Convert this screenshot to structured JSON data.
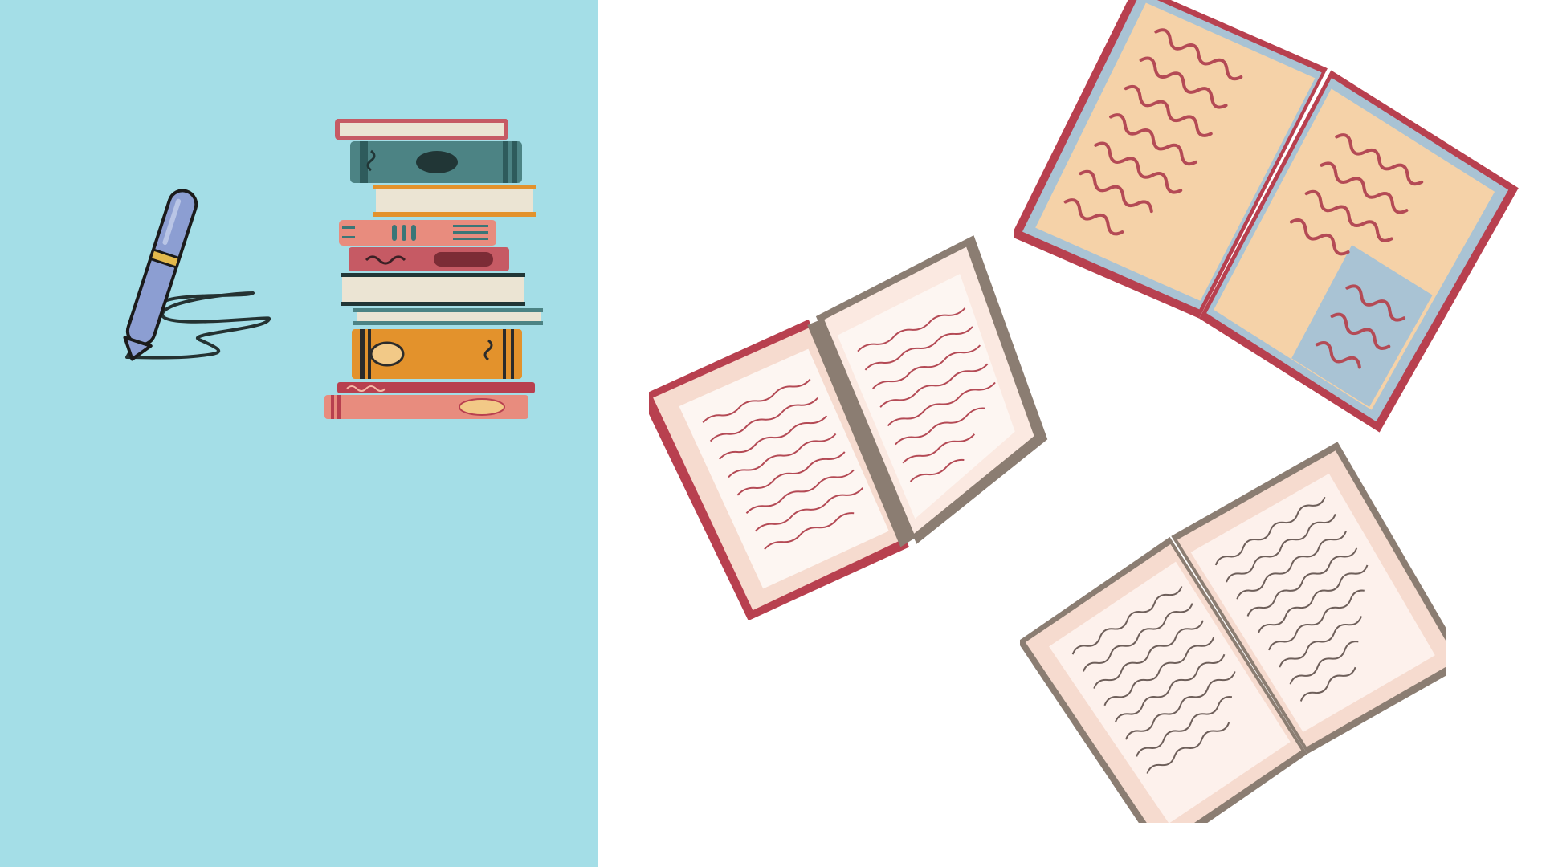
{
  "colors": {
    "panel_background": "#a4dee7",
    "page_background": "#ffffff",
    "pen_body": "#8c9ed2",
    "pen_band": "#e3b94c",
    "scribble_ink": "#243232",
    "book_teal": "#4c8384",
    "book_cream": "#ebe4d3",
    "book_pink": "#e88c7e",
    "book_rose": "#c65a64",
    "book_orange": "#e3922c",
    "book_maroon": "#b8404f",
    "page_peach": "#f5d2a8",
    "page_blue": "#a9c3d4",
    "page_blush": "#f6dbcf",
    "text_squiggle": "#b44a55",
    "cover_taupe": "#8b7d72"
  },
  "illustrations": {
    "pen": "pen-signature-icon",
    "book_stack": "book-stack-icon",
    "open_book_left": "open-book-icon",
    "open_book_top_right": "open-book-icon",
    "open_book_bottom_right": "open-book-icon"
  }
}
